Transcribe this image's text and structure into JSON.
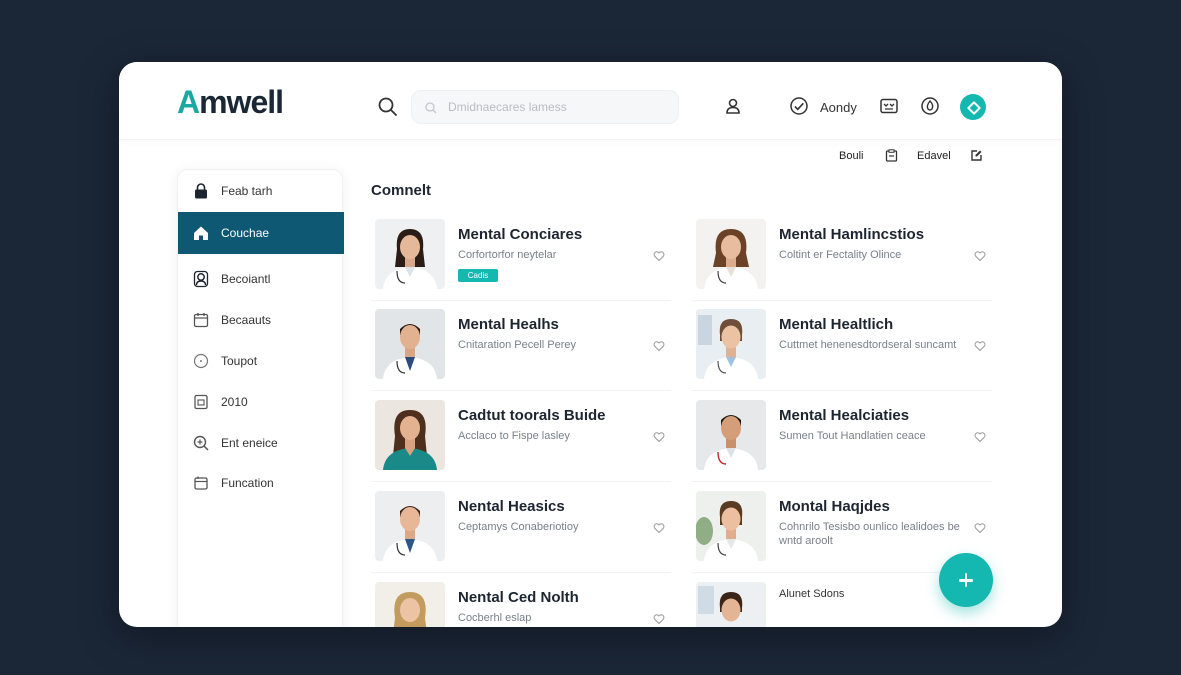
{
  "app": {
    "logo": "Amwell"
  },
  "header": {
    "search_placeholder": "Dmidnaecares lamess",
    "user_name": "Aondy",
    "sub_links": [
      "Bouli",
      "Edavel"
    ]
  },
  "sidebar": {
    "items": [
      {
        "label": "Feab tarh",
        "icon": "lock-icon",
        "active": false
      },
      {
        "label": "Couchae",
        "icon": "home-icon",
        "active": true
      },
      {
        "label": "Becoiantl",
        "icon": "user-icon",
        "active": false
      },
      {
        "label": "Becaauts",
        "icon": "calendar-icon",
        "active": false
      },
      {
        "label": "Toupot",
        "icon": "clock-icon",
        "active": false
      },
      {
        "label": "2010",
        "icon": "document-icon",
        "active": false
      },
      {
        "label": "Ent eneice",
        "icon": "search-plus-icon",
        "active": false
      },
      {
        "label": "Funcation",
        "icon": "folder-icon",
        "active": false
      }
    ]
  },
  "main": {
    "section_title": "Comnelt",
    "cards": [
      {
        "title": "Mental Conciares",
        "subtitle": "Corfortorfor neytelar",
        "badge": "Cadis"
      },
      {
        "title": "Mental Hamlincstios",
        "subtitle": "Coltint er Fectality Olince",
        "badge": ""
      },
      {
        "title": "Mental Healhs",
        "subtitle": "Cnitaration Pecell Perey",
        "badge": ""
      },
      {
        "title": "Mental Healtlich",
        "subtitle": "Cuttmet henenesdtordseral suncamt",
        "badge": ""
      },
      {
        "title": "Cadtut toorals Buide",
        "subtitle": "Acclaco to Fispe lasley",
        "badge": ""
      },
      {
        "title": "Mental Healciaties",
        "subtitle": "Sumen Tout Handlatien ceace",
        "badge": ""
      },
      {
        "title": "Nental Heasics",
        "subtitle": "Ceptamys Conaberiotioy",
        "badge": ""
      },
      {
        "title": "Montal Haqjdes",
        "subtitle": "Cohnrilo Tesisbo ounlico lealidoes be wntd aroolt",
        "badge": ""
      },
      {
        "title": "Nental Ced Nolth",
        "subtitle": "Cocberhl eslap",
        "badge": ""
      },
      {
        "title": "",
        "subtitle": "Alunet Sdons",
        "badge": ""
      }
    ]
  },
  "colors": {
    "accent": "#14b8b0",
    "sidebar_active": "#0f5874",
    "background": "#1b2637"
  }
}
